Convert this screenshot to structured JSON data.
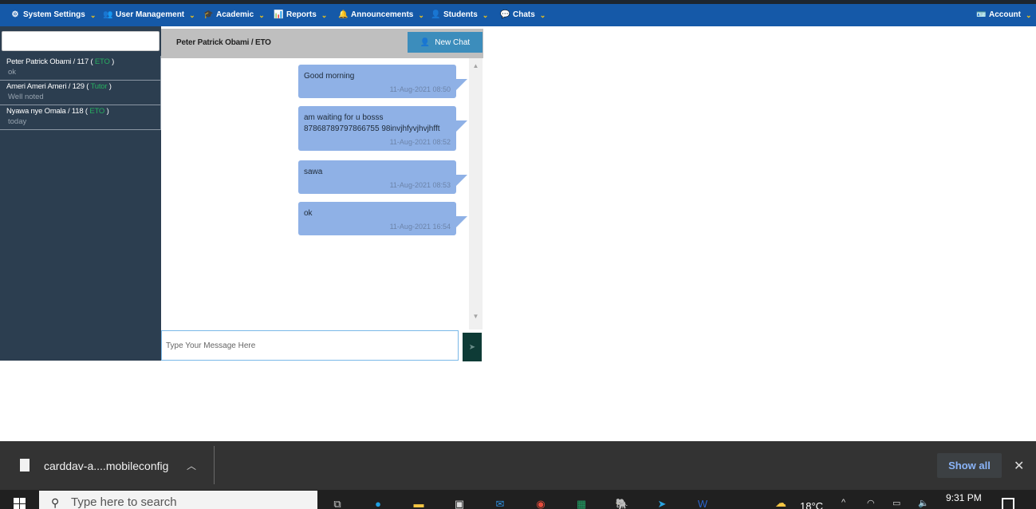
{
  "nav": {
    "items": [
      {
        "label": "System Settings",
        "icon": "cogs-icon"
      },
      {
        "label": "User Management",
        "icon": "users-icon"
      },
      {
        "label": "Academic",
        "icon": "graduation-cap-icon"
      },
      {
        "label": "Reports",
        "icon": "bar-chart-icon"
      },
      {
        "label": "Announcements",
        "icon": "bell-icon"
      },
      {
        "label": "Students",
        "icon": "student-icon"
      },
      {
        "label": "Chats",
        "icon": "chat-bubble-icon"
      }
    ],
    "account_label": "Account",
    "accent_color": "#1559a8",
    "chevron_color": "#f0c419"
  },
  "sidebar": {
    "search_value": "",
    "chats": [
      {
        "name": "Peter Patrick Obami / 117 (",
        "role": "ETO",
        "close": ")",
        "last": "ok"
      },
      {
        "name": "Ameri Ameri Ameri / 129 (",
        "role": "Tutor",
        "close": ")",
        "last": "Well noted"
      },
      {
        "name": "Nyawa nye Omala / 118 (",
        "role": "ETO",
        "close": ")",
        "last": "today"
      }
    ]
  },
  "chat": {
    "title": "Peter Patrick Obami / ETO",
    "new_chat_label": "New Chat",
    "messages": [
      {
        "text": "Good morning",
        "time": "11-Aug-2021 08:50"
      },
      {
        "text": "am waiting for u bosss 87868789797866755 98invjhfyvjhvjhfft",
        "time": "11-Aug-2021 08:52"
      },
      {
        "text": "sawa",
        "time": "11-Aug-2021 08:53"
      },
      {
        "text": "ok",
        "time": "11-Aug-2021 16:54"
      }
    ],
    "input_placeholder": "Type Your Message Here",
    "bubble_color": "#8fb1e6"
  },
  "download_bar": {
    "file_name": "carddav-a....mobileconfig",
    "show_all_label": "Show all"
  },
  "taskbar": {
    "search_placeholder": "Type here to search",
    "temperature": "18°C",
    "time": "9:31 PM"
  }
}
